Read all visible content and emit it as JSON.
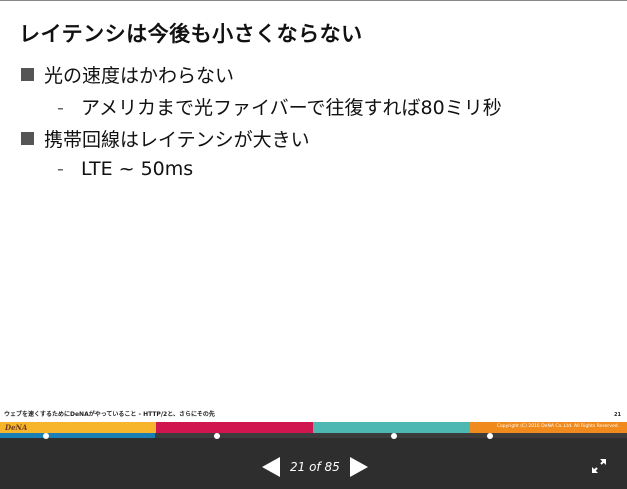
{
  "slide": {
    "title": "レイテンシは今後も小さくならない",
    "bullets": [
      {
        "text": "光の速度はかわらない",
        "sub": "アメリカまで光ファイバーで往復すれば80ミリ秒"
      },
      {
        "text": "携帯回線はレイテンシが大きい",
        "sub": "LTE ~ 50ms"
      }
    ],
    "sub_dash": "-",
    "footer": {
      "talk_title": "ウェブを速くするためにDeNAがやっていること - HTTP/2と、さらにその先",
      "page_number": "21",
      "logo": "DeNA",
      "copyright": "Copyright (C) 2016 DeNA Co.,Ltd. All Rights Reserved.",
      "colors": [
        "#f7b52c",
        "#d0154f",
        "#4db8b1",
        "#f08a1d"
      ]
    }
  },
  "viewer": {
    "current_page": 21,
    "total_pages": 85,
    "page_indicator": "21 of 85",
    "progress_fraction": 0.247,
    "progress_color": "#1a7fb5",
    "prev_icon": "left-triangle-icon",
    "next_icon": "right-triangle-icon",
    "fullscreen_icon": "expand-icon"
  }
}
